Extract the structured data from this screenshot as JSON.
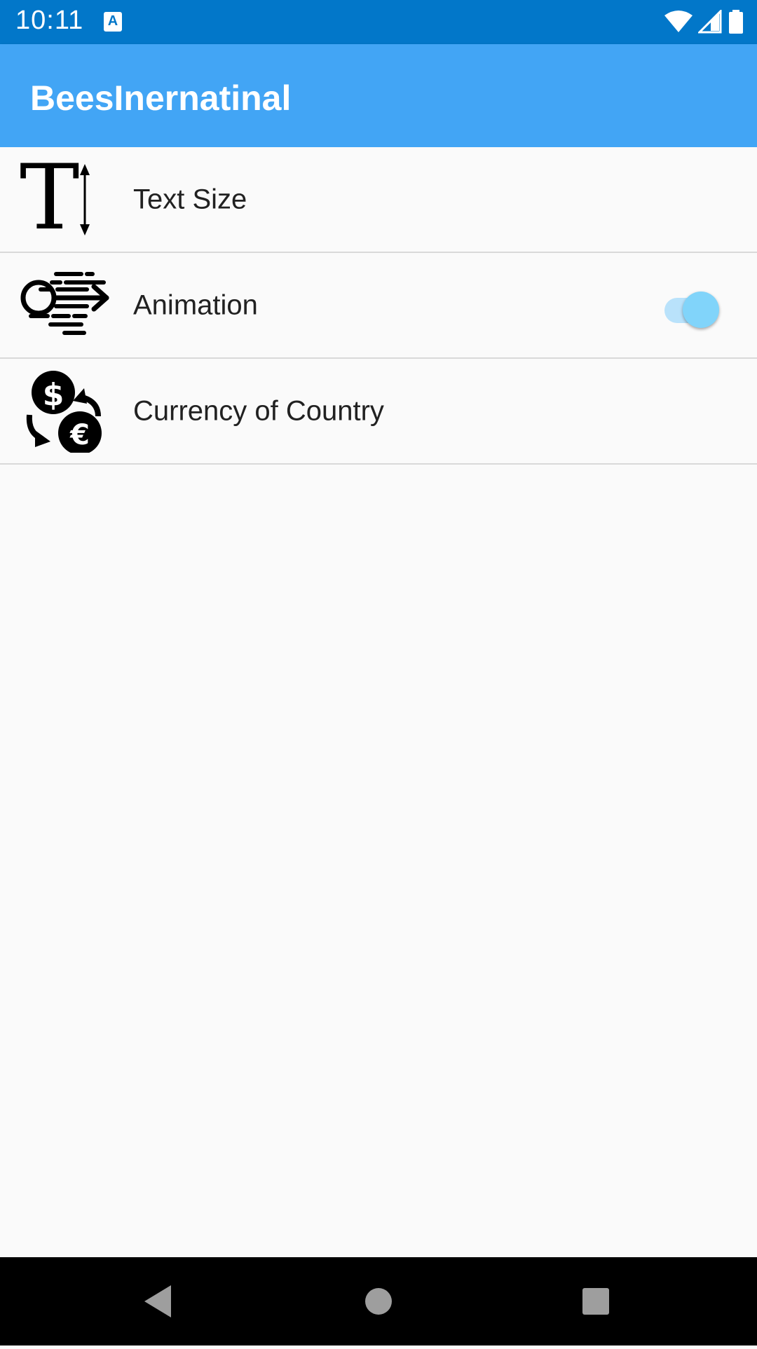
{
  "status_bar": {
    "time": "10:11",
    "notification_icon": "app-notification-icon",
    "icons": [
      "wifi-icon",
      "signal-icon",
      "battery-icon"
    ]
  },
  "app_bar": {
    "title": "BeesInernatinal",
    "color": "#42a5f5"
  },
  "settings": [
    {
      "label": "Text Size",
      "icon": "text-size-icon"
    },
    {
      "label": "Animation",
      "icon": "animation-icon",
      "toggle_on": true
    },
    {
      "label": "Currency of Country",
      "icon": "currency-exchange-icon"
    }
  ],
  "nav_bar": {
    "buttons": [
      "back-icon",
      "home-icon",
      "recent-apps-icon"
    ]
  },
  "colors": {
    "status_bar": "#0277c9",
    "app_bar": "#42a5f5",
    "toggle_thumb": "#81d4fa",
    "toggle_track": "#b9e2fb"
  }
}
